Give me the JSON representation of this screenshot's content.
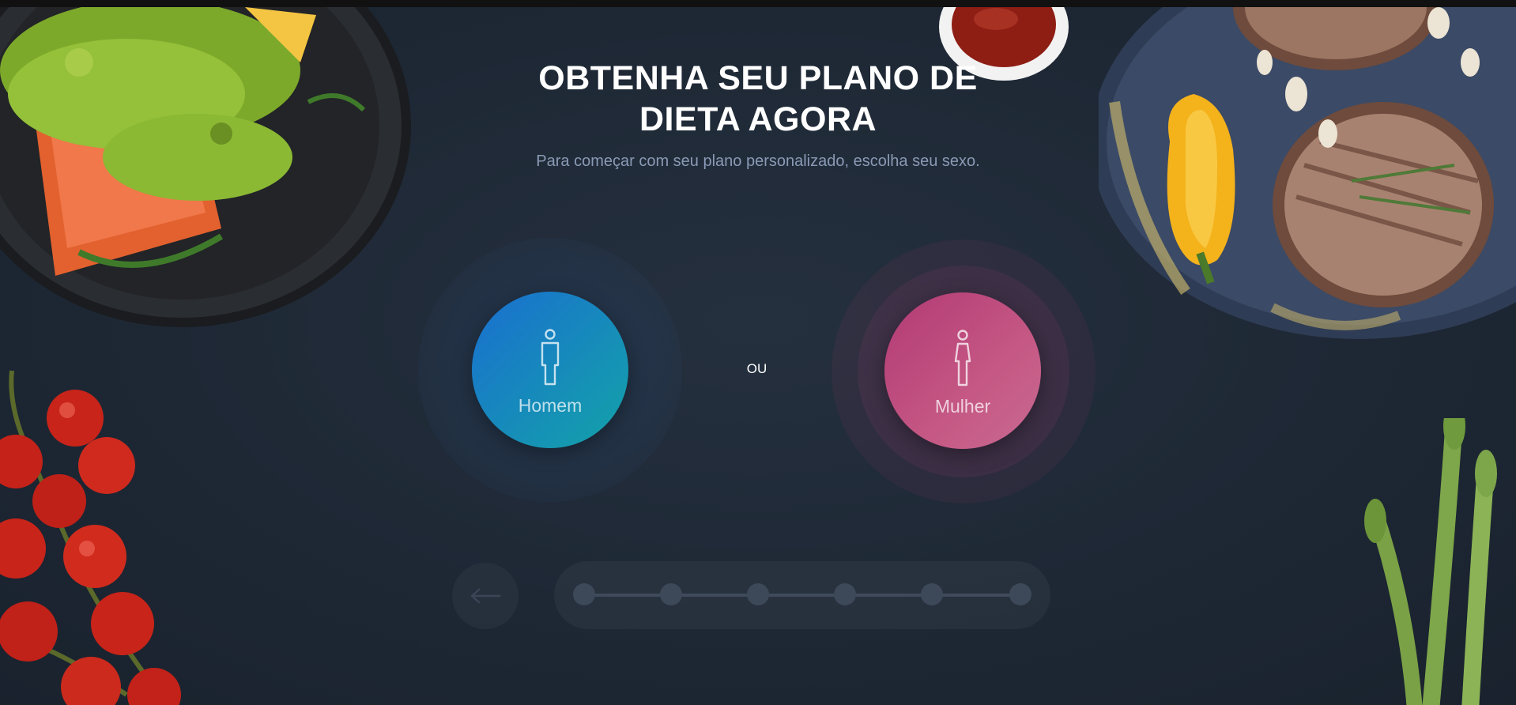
{
  "page": {
    "title": "OBTENHA SEU PLANO DE DIETA AGORA",
    "subtitle": "Para começar com seu plano personalizado, escolha seu sexo."
  },
  "choices": {
    "male": {
      "label": "Homem",
      "icon": "male-person-icon"
    },
    "separator": "OU",
    "female": {
      "label": "Mulher",
      "icon": "female-person-icon"
    }
  },
  "navigation": {
    "back_icon": "arrow-left-icon",
    "steps_total": 6,
    "current_step": 1
  },
  "colors": {
    "background": "#1f2a37",
    "male_gradient_start": "#1a6fd0",
    "male_gradient_end": "#13a3a8",
    "female_gradient_start": "#b23a74",
    "female_gradient_end": "#c86a91",
    "title": "#ffffff",
    "subtitle": "#8a9ab5"
  }
}
